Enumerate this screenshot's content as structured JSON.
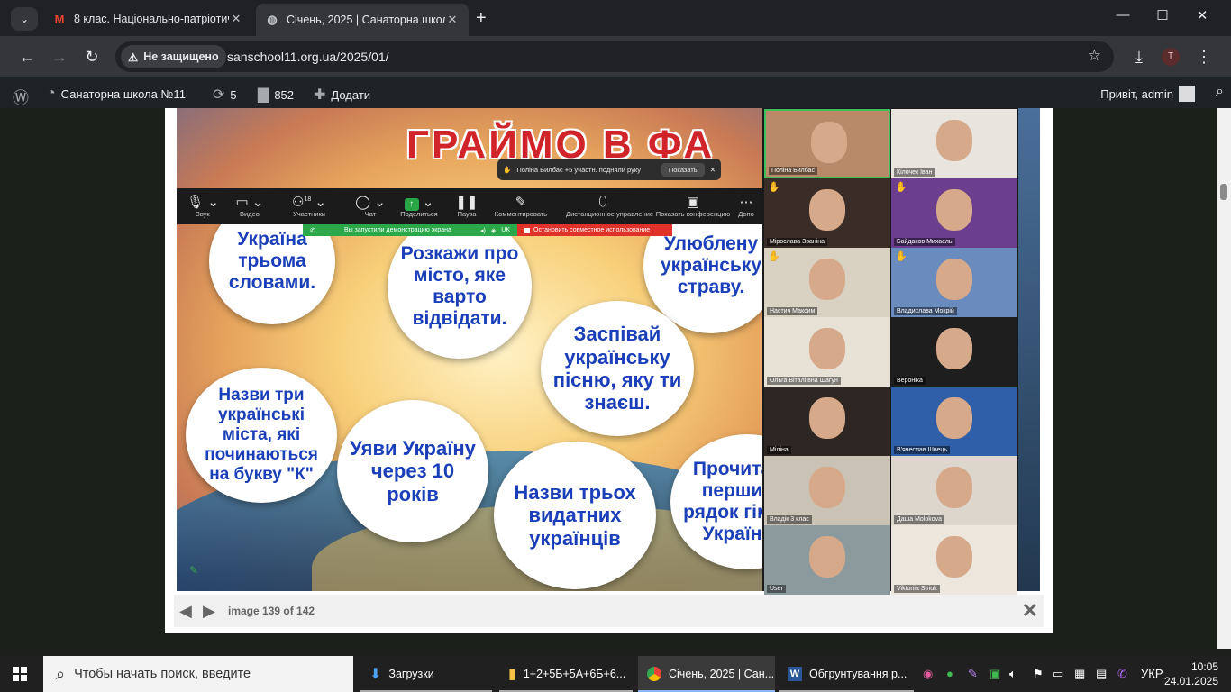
{
  "browser": {
    "tabs": [
      {
        "title": "8 клас. Національно-патріотичн",
        "favicon": "gmail-icon"
      },
      {
        "title": "Січень, 2025 | Санаторна школа",
        "favicon": "globe-icon"
      }
    ],
    "security_label": "Не защищено",
    "url": "sanschool11.org.ua/2025/01/",
    "profile_initial": "T"
  },
  "wp_admin_bar": {
    "site_name": "Санаторна школа №11",
    "updates_count": "5",
    "comments_count": "852",
    "add_label": "Додати",
    "greeting": "Привіт, admin"
  },
  "slide": {
    "title": "ГРАЙМО В ФА",
    "bubbles": [
      "Україна трьома словами.",
      "Розкажи про місто, яке варто відвідати.",
      "Улюблену українську страву.",
      "Заспівай українську пісню, яку ти знаєш.",
      "Назви три українські міста, які починаються на букву \"К\"",
      "Уяви Україну через 10 років",
      "Назви трьох видатних українців",
      "Прочитай перший рядок гімну України"
    ]
  },
  "zoom": {
    "toolbar": [
      {
        "label": "Звук",
        "icon": "microphone-icon"
      },
      {
        "label": "Видео",
        "icon": "camera-icon"
      },
      {
        "label": "Участники",
        "icon": "participants-icon",
        "count": "18"
      },
      {
        "label": "Чат",
        "icon": "chat-icon"
      },
      {
        "label": "Поделиться",
        "icon": "share-screen-icon"
      },
      {
        "label": "Пауза",
        "icon": "pause-icon"
      },
      {
        "label": "Комментировать",
        "icon": "pen-icon"
      },
      {
        "label": "Дистанционное управление",
        "icon": "mouse-icon"
      },
      {
        "label": "Показать конференцию",
        "icon": "monitor-icon"
      },
      {
        "label": "Допо",
        "icon": "more-icon"
      }
    ],
    "hand_notice": "Поліна Билбас +5 участн. подняли руку",
    "hand_show": "Показать",
    "share_notice": "Вы запустили демонстрацию экрана",
    "share_lang": "UK",
    "stop_share": "Остановить совместное использование",
    "participants": [
      {
        "name": "Поліна Билбас",
        "hand": false,
        "active": true,
        "bg": "#b98a6a"
      },
      {
        "name": "Кілочек Іван",
        "hand": false,
        "active": false,
        "bg": "#e9e4dd"
      },
      {
        "name": "Мірослава Званіна",
        "hand": true,
        "active": false,
        "bg": "#3a2d28"
      },
      {
        "name": "Байдаков Михаель",
        "hand": true,
        "active": false,
        "bg": "#6b3e8e"
      },
      {
        "name": "Настич Максим",
        "hand": true,
        "active": false,
        "bg": "#d9d2c2"
      },
      {
        "name": "Владислава Мокрій",
        "hand": true,
        "active": false,
        "bg": "#6a8bbd"
      },
      {
        "name": "Ольга Віталіївна Шагун",
        "hand": false,
        "active": false,
        "bg": "#e7e1d6"
      },
      {
        "name": "Вероніка",
        "hand": false,
        "active": false,
        "bg": "#1e1e1e"
      },
      {
        "name": "Міліна",
        "hand": false,
        "active": false,
        "bg": "#2e2622"
      },
      {
        "name": "В'ячеслав Швець",
        "hand": false,
        "active": false,
        "bg": "#2f5fa8"
      },
      {
        "name": "Владік 3 клас",
        "hand": false,
        "active": false,
        "bg": "#c9c2b5"
      },
      {
        "name": "Даша Molokova",
        "hand": false,
        "active": false,
        "bg": "#dcd6cc"
      },
      {
        "name": "User",
        "hand": false,
        "active": false,
        "bg": "#8a9a9d"
      },
      {
        "name": "Viktoriia Striuk",
        "hand": false,
        "active": false,
        "bg": "#ece6dc"
      }
    ]
  },
  "lightbox": {
    "caption": "image 139 of 142"
  },
  "taskbar": {
    "search_placeholder": "Чтобы начать поиск, введите",
    "apps": [
      {
        "label": "Загрузки"
      },
      {
        "label": "1+2+5Б+5А+6Б+6..."
      },
      {
        "label": "Січень, 2025 | Сан..."
      },
      {
        "label": "Обгрунтування р..."
      }
    ],
    "language": "УКР",
    "time": "10:05",
    "date": "24.01.2025"
  }
}
